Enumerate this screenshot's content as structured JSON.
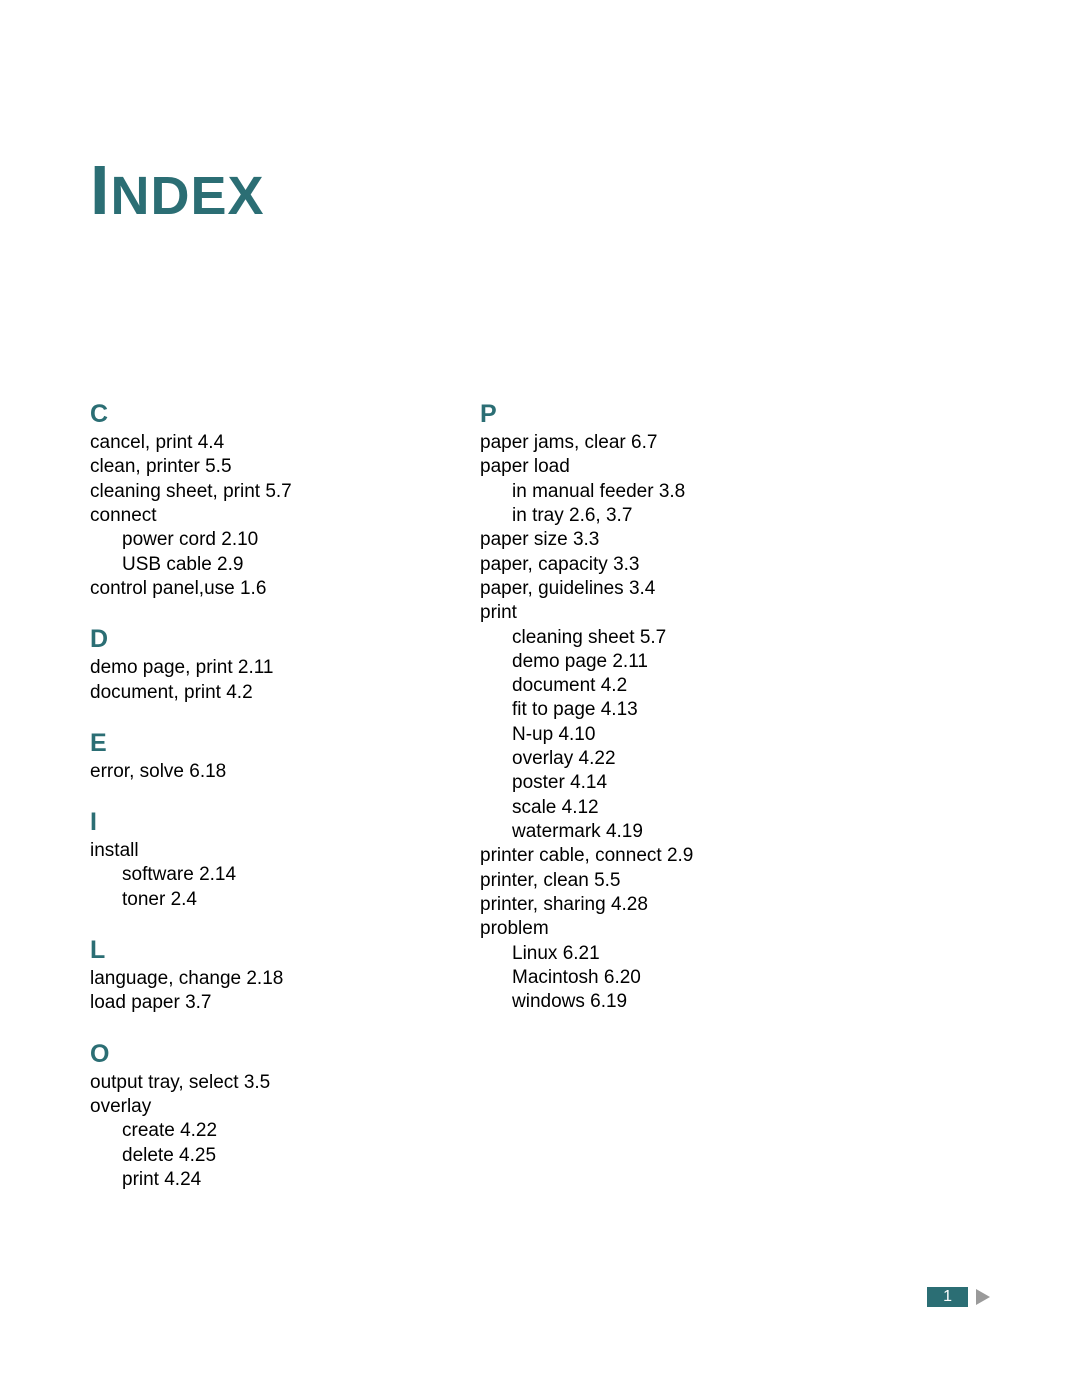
{
  "title_first": "I",
  "title_rest": "NDEX",
  "page_number": "1",
  "index": {
    "col1": [
      {
        "letter": "C",
        "entries": [
          {
            "text": "cancel, print 4.4"
          },
          {
            "text": "clean, printer 5.5"
          },
          {
            "text": "cleaning sheet, print 5.7"
          },
          {
            "text": "connect"
          },
          {
            "text": "power cord 2.10",
            "sub": true
          },
          {
            "text": "USB cable 2.9",
            "sub": true
          },
          {
            "text": "control panel,use 1.6"
          }
        ]
      },
      {
        "letter": "D",
        "entries": [
          {
            "text": "demo page, print 2.11"
          },
          {
            "text": "document, print 4.2"
          }
        ]
      },
      {
        "letter": "E",
        "entries": [
          {
            "text": "error, solve 6.18"
          }
        ]
      },
      {
        "letter": "I",
        "entries": [
          {
            "text": "install"
          },
          {
            "text": "software 2.14",
            "sub": true
          },
          {
            "text": "toner 2.4",
            "sub": true
          }
        ]
      },
      {
        "letter": "L",
        "entries": [
          {
            "text": "language, change 2.18"
          },
          {
            "text": "load paper 3.7"
          }
        ]
      },
      {
        "letter": "O",
        "entries": [
          {
            "text": "output tray, select 3.5"
          },
          {
            "text": "overlay"
          },
          {
            "text": "create 4.22",
            "sub": true
          },
          {
            "text": "delete 4.25",
            "sub": true
          },
          {
            "text": "print 4.24",
            "sub": true
          }
        ]
      }
    ],
    "col2": [
      {
        "letter": "P",
        "entries": [
          {
            "text": "paper jams, clear 6.7"
          },
          {
            "text": "paper load"
          },
          {
            "text": "in manual feeder 3.8",
            "sub": true
          },
          {
            "text": "in tray 2.6, 3.7",
            "sub": true
          },
          {
            "text": "paper size 3.3"
          },
          {
            "text": "paper, capacity 3.3"
          },
          {
            "text": "paper, guidelines 3.4"
          },
          {
            "text": "print"
          },
          {
            "text": "cleaning sheet 5.7",
            "sub": true
          },
          {
            "text": "demo page 2.11",
            "sub": true
          },
          {
            "text": "document 4.2",
            "sub": true
          },
          {
            "text": "fit to page 4.13",
            "sub": true
          },
          {
            "text": "N-up 4.10",
            "sub": true
          },
          {
            "text": "overlay 4.22",
            "sub": true
          },
          {
            "text": "poster 4.14",
            "sub": true
          },
          {
            "text": "scale 4.12",
            "sub": true
          },
          {
            "text": "watermark 4.19",
            "sub": true
          },
          {
            "text": "printer cable, connect 2.9"
          },
          {
            "text": "printer, clean 5.5"
          },
          {
            "text": "printer, sharing 4.28"
          },
          {
            "text": "problem"
          },
          {
            "text": "Linux 6.21",
            "sub": true
          },
          {
            "text": "Macintosh 6.20",
            "sub": true
          },
          {
            "text": "windows 6.19",
            "sub": true
          }
        ]
      }
    ]
  }
}
